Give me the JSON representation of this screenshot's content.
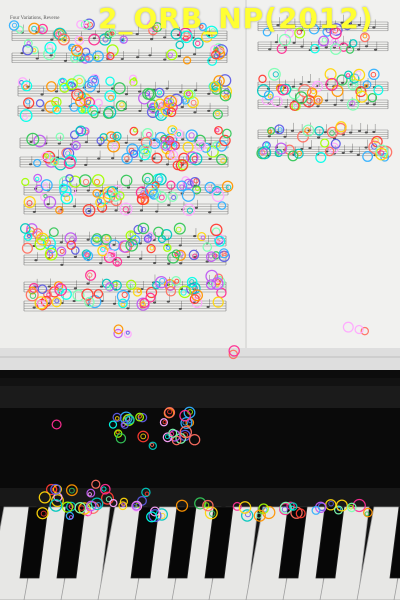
{
  "overlay": {
    "label": "2_ORB_NP(2012)",
    "color": "#ffff33"
  },
  "sheet": {
    "title": "Four Variations, Reverse"
  },
  "colors": {
    "background": "#0c0c0c",
    "paper": "#eeeeec",
    "paper_shadow": "#d9d9d7",
    "staff_lines": "#7a7a7a",
    "note_ink": "#1f1f1f",
    "piano_body": "#121212",
    "white_keys": "#e7e7e5",
    "black_keys": "#070707"
  },
  "keypoint_palette": [
    "#ff3b30",
    "#ff9500",
    "#ffd60a",
    "#34c759",
    "#00c7be",
    "#30b0ff",
    "#5e5ce6",
    "#bf5af2",
    "#ff2d92",
    "#a2ff00",
    "#00ffea",
    "#ff6f61",
    "#7cffb2",
    "#ffa6ff"
  ],
  "icons": {
    "feature_marker": "ring-marker-icon"
  }
}
